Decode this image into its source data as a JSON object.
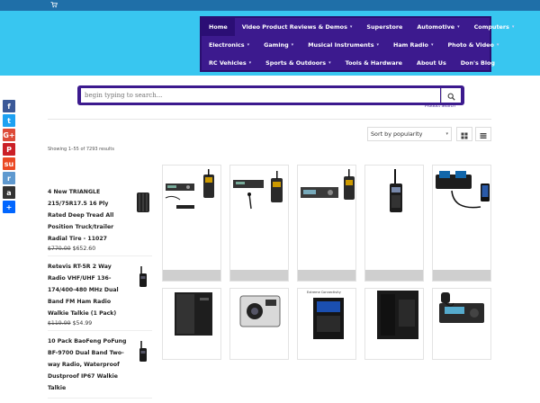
{
  "menu": {
    "row1": [
      {
        "label": "Home",
        "active": true,
        "caret": false
      },
      {
        "label": "Video Product Reviews & Demos",
        "caret": true
      },
      {
        "label": "Superstore",
        "caret": false
      },
      {
        "label": "Automotive",
        "caret": true
      },
      {
        "label": "Computers",
        "caret": true
      }
    ],
    "row2": [
      {
        "label": "Electronics",
        "caret": true
      },
      {
        "label": "Gaming",
        "caret": true
      },
      {
        "label": "Musical Instruments",
        "caret": true
      },
      {
        "label": "Ham Radio",
        "caret": true
      },
      {
        "label": "Photo & Video",
        "caret": true
      }
    ],
    "row3": [
      {
        "label": "RC Vehicles",
        "caret": true
      },
      {
        "label": "Sports & Outdoors",
        "caret": true
      },
      {
        "label": "Tools & Hardware",
        "caret": false
      },
      {
        "label": "About Us",
        "caret": false
      },
      {
        "label": "Don's Blog",
        "caret": false
      }
    ],
    "caret_glyph": "▾"
  },
  "search": {
    "placeholder": "begin typing to search...",
    "caption": "Product Search"
  },
  "social": [
    {
      "icon": "facebook-icon",
      "glyph": "f",
      "color": "#3b5998"
    },
    {
      "icon": "twitter-icon",
      "glyph": "t",
      "color": "#1da1f2"
    },
    {
      "icon": "google-plus-icon",
      "glyph": "G+",
      "color": "#dd4b39"
    },
    {
      "icon": "pinterest-icon",
      "glyph": "P",
      "color": "#cb2027"
    },
    {
      "icon": "stumbleupon-icon",
      "glyph": "su",
      "color": "#eb4924"
    },
    {
      "icon": "reddit-icon",
      "glyph": "r",
      "color": "#5f99cf"
    },
    {
      "icon": "amazon-icon",
      "glyph": "a",
      "color": "#333333"
    },
    {
      "icon": "share-plus-icon",
      "glyph": "+",
      "color": "#0166ff"
    }
  ],
  "toolbar": {
    "sort_value": "Sort by popularity",
    "sort_caret": "▾",
    "results_text": "Showing 1–55 of 7293 results"
  },
  "side_products": [
    {
      "title": "4 New TRIANGLE 215/75R17.5 16 Ply Rated Deep Tread All Position Truck/trailer Radial Tire - 11027",
      "old_price": "$770.00",
      "price": "$652.60",
      "thumb": "tire"
    },
    {
      "title": "Retevis RT-5R 2 Way Radio VHF/UHF 136-174/400-480 MHz Dual Band FM Ham Radio Walkie Talkie (1 Pack)",
      "old_price": "$119.99",
      "price": "$54.99",
      "thumb": "radio"
    },
    {
      "title": "10 Pack BaoFeng PoFung BF-9700 Dual Band Two-way Radio, Waterproof Dustproof IP67 Walkie Talkie",
      "old_price": "",
      "price": "",
      "thumb": "radio"
    }
  ],
  "product_cards": [
    {
      "image": "wireless-mic-system"
    },
    {
      "image": "lavalier-mic-system"
    },
    {
      "image": "wireless-receiver"
    },
    {
      "image": "handheld-radio"
    },
    {
      "image": "battery-charger"
    },
    {
      "image": "pc-tower"
    },
    {
      "image": "action-camera"
    },
    {
      "image": "gaming-pc-case",
      "brand_text": "Extreme Connectivity"
    },
    {
      "image": "pc-case-black"
    },
    {
      "image": "mobile-ham-radio"
    }
  ]
}
